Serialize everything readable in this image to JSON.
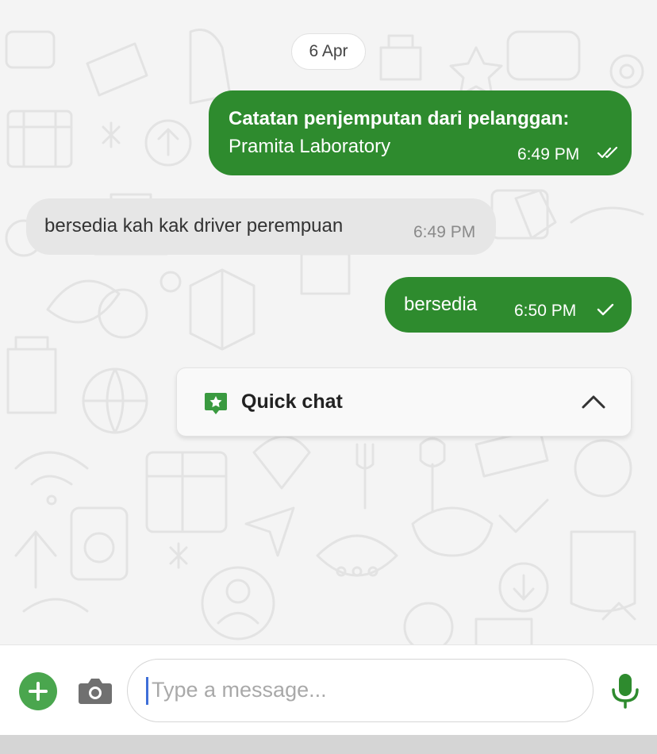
{
  "date_pill": "6 Apr",
  "messages": [
    {
      "direction": "outgoing",
      "title": "Catatan penjemputan dari pelanggan:",
      "text": "Pramita Laboratory",
      "time": "6:49 PM",
      "status": "read"
    },
    {
      "direction": "incoming",
      "text": "bersedia kah kak driver perempuan",
      "time": "6:49 PM"
    },
    {
      "direction": "outgoing",
      "text": "bersedia",
      "time": "6:50 PM",
      "status": "sent"
    }
  ],
  "quick_chat": {
    "label": "Quick chat",
    "icon": "chat-star-icon",
    "toggle_icon": "chevron-up-icon"
  },
  "input_bar": {
    "placeholder": "Type a message...",
    "attach_icon": "plus-icon",
    "camera_icon": "camera-icon",
    "mic_icon": "microphone-icon"
  },
  "colors": {
    "accent": "#2e8b2e",
    "attach": "#4aa64e",
    "incoming_bubble": "#e6e6e6",
    "chat_background": "#f4f4f4"
  }
}
